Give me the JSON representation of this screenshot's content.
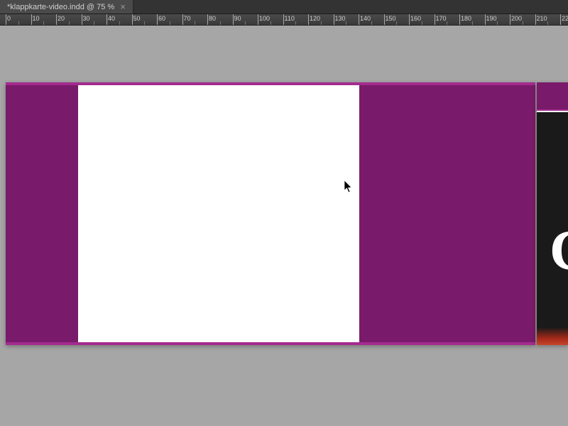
{
  "tab": {
    "title": "*klappkarte-video.indd @ 75 %",
    "close_glyph": "×"
  },
  "ruler": {
    "start": 0,
    "step": 10,
    "count": 23,
    "pixelsPerUnit": 3.55
  },
  "right_page_glyph": "C"
}
